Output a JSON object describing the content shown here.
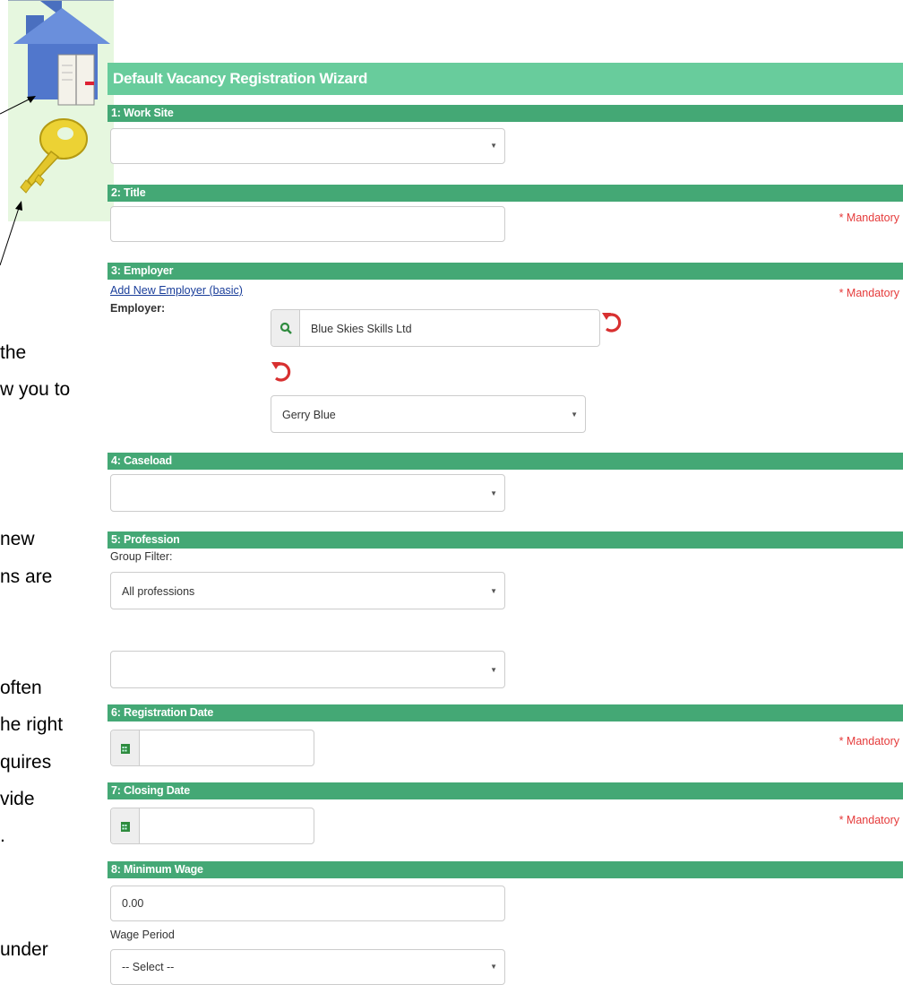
{
  "wizard_title": "Default Vacancy Registration Wizard",
  "sections": {
    "work_site": "1: Work Site",
    "title": "2: Title",
    "employer": "3: Employer",
    "caseload": "4: Caseload",
    "profession": "5: Profession",
    "registration_date": "6: Registration Date",
    "closing_date": "7: Closing Date",
    "minimum_wage": "8: Minimum Wage"
  },
  "mandatory_label": "* Mandatory",
  "employer": {
    "add_link": "Add New Employer (basic)",
    "label": "Employer:",
    "value": "Blue Skies Skills Ltd",
    "contact": "Gerry Blue"
  },
  "profession": {
    "group_filter_label": "Group Filter:",
    "group_filter_value": "All professions"
  },
  "minimum_wage": {
    "value": "0.00",
    "wage_period_label": "Wage Period",
    "wage_period_value": "-- Select --"
  },
  "doc_fragments": [
    "the",
    "w you to",
    "new",
    "ns are",
    "often",
    "he right",
    "quires",
    "vide",
    ".",
    "under"
  ],
  "colors": {
    "header_light": "#68cc9c",
    "header_dark": "#44a875",
    "mandatory": "#e53a3a",
    "reset_icon": "#d83030"
  }
}
